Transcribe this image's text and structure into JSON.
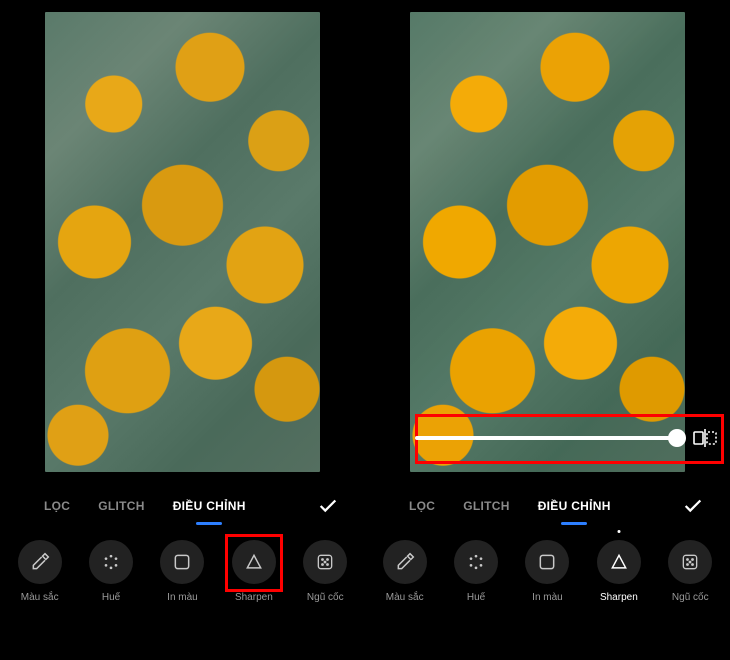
{
  "tabs": {
    "filter": "LỌC",
    "glitch": "GLITCH",
    "adjust": "ĐIỀU CHỈNH"
  },
  "tools": {
    "color": "Màu sắc",
    "hue": "Huế",
    "blur": "In màu",
    "sharpen": "Sharpen",
    "grain": "Ngũ cốc"
  },
  "slider": {
    "value": 100
  }
}
